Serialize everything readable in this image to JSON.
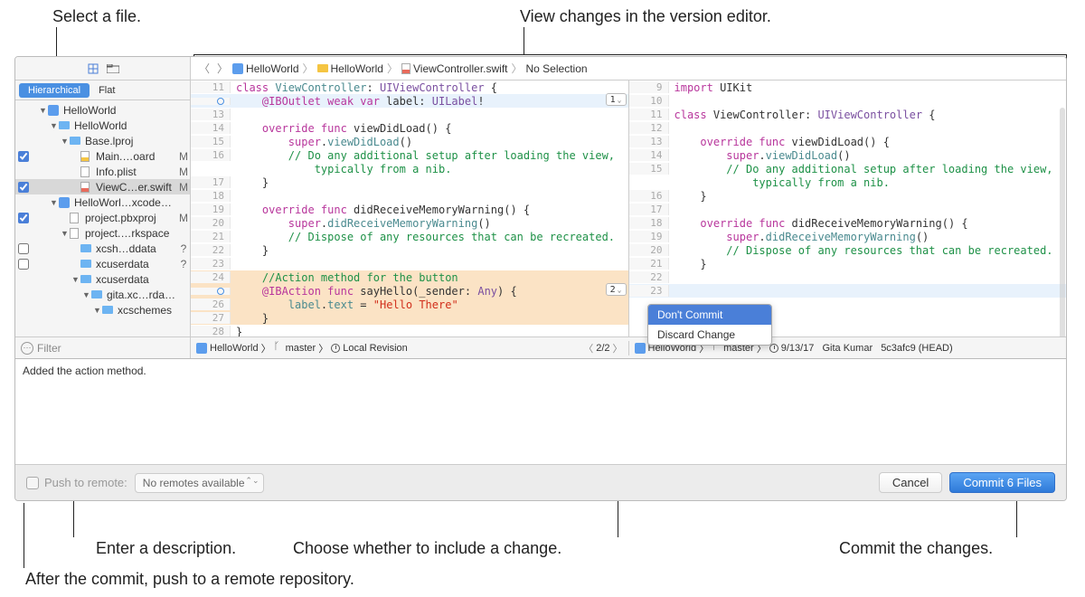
{
  "annotations": {
    "select_file": "Select a file.",
    "view_changes": "View changes in the version editor.",
    "enter_desc": "Enter a description.",
    "choose_include": "Choose whether to include a change.",
    "commit_changes": "Commit the changes.",
    "push_remote": "After the commit, push to a remote repository."
  },
  "sidebar": {
    "viewmode": {
      "hierarchical": "Hierarchical",
      "flat": "Flat"
    },
    "filter_placeholder": "Filter",
    "tree": [
      {
        "depth": 0,
        "cb": null,
        "disc": "▼",
        "icon": "proj",
        "name": "HelloWorld",
        "status": ""
      },
      {
        "depth": 1,
        "cb": null,
        "disc": "▼",
        "icon": "fold",
        "name": "HelloWorld",
        "status": ""
      },
      {
        "depth": 2,
        "cb": null,
        "disc": "▼",
        "icon": "fold",
        "name": "Base.lproj",
        "status": ""
      },
      {
        "depth": 3,
        "cb": true,
        "disc": "",
        "icon": "docy",
        "name": "Main.…oard",
        "status": "M"
      },
      {
        "depth": 3,
        "cb": null,
        "disc": "",
        "icon": "docp",
        "name": "Info.plist",
        "status": "M"
      },
      {
        "depth": 3,
        "cb": true,
        "disc": "",
        "icon": "docr",
        "name": "ViewC…er.swift",
        "status": "M",
        "selected": true
      },
      {
        "depth": 1,
        "cb": null,
        "disc": "▼",
        "icon": "proj",
        "name": "HelloWorl…xcodeproj",
        "status": ""
      },
      {
        "depth": 2,
        "cb": true,
        "disc": "",
        "icon": "docp",
        "name": "project.pbxproj",
        "status": "M"
      },
      {
        "depth": 2,
        "cb": null,
        "disc": "▼",
        "icon": "docp",
        "name": "project.…rkspace",
        "status": ""
      },
      {
        "depth": 3,
        "cb": false,
        "disc": "",
        "icon": "fold",
        "name": "xcsh…ddata",
        "status": "?"
      },
      {
        "depth": 3,
        "cb": false,
        "disc": "",
        "icon": "fold",
        "name": "xcuserdata",
        "status": "?"
      },
      {
        "depth": 3,
        "cb": null,
        "disc": "▼",
        "icon": "fold",
        "name": "xcuserdata",
        "status": ""
      },
      {
        "depth": 4,
        "cb": null,
        "disc": "▼",
        "icon": "fold",
        "name": "gita.xc…rdatad",
        "status": ""
      },
      {
        "depth": 5,
        "cb": null,
        "disc": "▼",
        "icon": "fold",
        "name": "xcschemes",
        "status": ""
      }
    ]
  },
  "jumpbar": {
    "p1": "HelloWorld",
    "p2": "HelloWorld",
    "p3": "ViewController.swift",
    "p4": "No Selection"
  },
  "left_code": [
    {
      "n": "11",
      "mark": false,
      "hl": "",
      "html": "<span class='kw'>class</span> <span class='ident'>ViewController</span>: <span class='type'>UIViewController</span> {"
    },
    {
      "n": "",
      "mark": true,
      "hl": "blue",
      "html": "    <span class='kw'>@IBOutlet weak var</span> label: <span class='type'>UILabel</span>!"
    },
    {
      "n": "13",
      "mark": false,
      "hl": "",
      "html": ""
    },
    {
      "n": "14",
      "mark": false,
      "hl": "",
      "html": "    <span class='kw'>override func</span> viewDidLoad() {"
    },
    {
      "n": "15",
      "mark": false,
      "hl": "",
      "html": "        <span class='kw'>super</span>.<span class='ident'>viewDidLoad</span>()"
    },
    {
      "n": "16",
      "mark": false,
      "hl": "",
      "html": "        <span class='cmt'>// Do any additional setup after loading the view,</span>"
    },
    {
      "n": "",
      "mark": false,
      "hl": "",
      "html": "            <span class='cmt'>typically from a nib.</span>"
    },
    {
      "n": "17",
      "mark": false,
      "hl": "",
      "html": "    }"
    },
    {
      "n": "18",
      "mark": false,
      "hl": "",
      "html": ""
    },
    {
      "n": "19",
      "mark": false,
      "hl": "",
      "html": "    <span class='kw'>override func</span> didReceiveMemoryWarning() {"
    },
    {
      "n": "20",
      "mark": false,
      "hl": "",
      "html": "        <span class='kw'>super</span>.<span class='ident'>didReceiveMemoryWarning</span>()"
    },
    {
      "n": "21",
      "mark": false,
      "hl": "",
      "html": "        <span class='cmt'>// Dispose of any resources that can be recreated.</span>"
    },
    {
      "n": "22",
      "mark": false,
      "hl": "",
      "html": "    }"
    },
    {
      "n": "23",
      "mark": false,
      "hl": "",
      "html": ""
    },
    {
      "n": "24",
      "mark": false,
      "hl": "peach",
      "html": "    <span class='cmt'>//Action method for the button</span>"
    },
    {
      "n": "",
      "mark": true,
      "hl": "peach",
      "html": "    <span class='kw'>@IBAction func</span> sayHello(_sender: <span class='type'>Any</span>) {"
    },
    {
      "n": "26",
      "mark": false,
      "hl": "peach",
      "html": "        <span class='ident'>label</span>.<span class='ident'>text</span> = <span class='str'>\"Hello There\"</span>"
    },
    {
      "n": "27",
      "mark": false,
      "hl": "peach",
      "html": "    }"
    },
    {
      "n": "28",
      "mark": false,
      "hl": "",
      "html": "}"
    }
  ],
  "right_code": [
    {
      "n": "9",
      "hl": "",
      "html": "<span class='kw'>import</span> UIKit"
    },
    {
      "n": "10",
      "hl": "",
      "html": ""
    },
    {
      "n": "11",
      "hl": "",
      "html": "<span class='kw'>class</span> ViewController: <span class='type'>UIViewController</span> {"
    },
    {
      "n": "12",
      "hl": "",
      "html": ""
    },
    {
      "n": "13",
      "hl": "",
      "html": "    <span class='kw'>override func</span> viewDidLoad() {"
    },
    {
      "n": "14",
      "hl": "",
      "html": "        <span class='kw'>super</span>.<span class='ident'>viewDidLoad</span>()"
    },
    {
      "n": "15",
      "hl": "",
      "html": "        <span class='cmt'>// Do any additional setup after loading the view,</span>"
    },
    {
      "n": "",
      "hl": "",
      "html": "            <span class='cmt'>typically from a nib.</span>"
    },
    {
      "n": "16",
      "hl": "",
      "html": "    }"
    },
    {
      "n": "17",
      "hl": "",
      "html": ""
    },
    {
      "n": "18",
      "hl": "",
      "html": "    <span class='kw'>override func</span> didReceiveMemoryWarning() {"
    },
    {
      "n": "19",
      "hl": "",
      "html": "        <span class='kw'>super</span>.<span class='ident'>didReceiveMemoryWarning</span>()"
    },
    {
      "n": "20",
      "hl": "",
      "html": "        <span class='cmt'>// Dispose of any resources that can be recreated.</span>"
    },
    {
      "n": "21",
      "hl": "",
      "html": "    }"
    },
    {
      "n": "22",
      "hl": "",
      "html": ""
    },
    {
      "n": "23",
      "hl": "blue",
      "html": ""
    }
  ],
  "steppers": {
    "s1": "1",
    "s2": "2"
  },
  "bottom_bar": {
    "left": {
      "proj": "HelloWorld",
      "branch": "master",
      "rev": "Local Revision"
    },
    "center": "2/2",
    "right": {
      "proj": "HelloWorld",
      "branch": "master",
      "date": "9/13/17",
      "author": "Gita Kumar",
      "hash": "5c3afc9 (HEAD)"
    }
  },
  "popup": {
    "dont_commit": "Don't Commit",
    "discard": "Discard Change"
  },
  "description": "Added the action method.",
  "footer": {
    "push_label": "Push to remote:",
    "remote_sel": "No remotes available",
    "cancel": "Cancel",
    "commit": "Commit 6 Files"
  }
}
